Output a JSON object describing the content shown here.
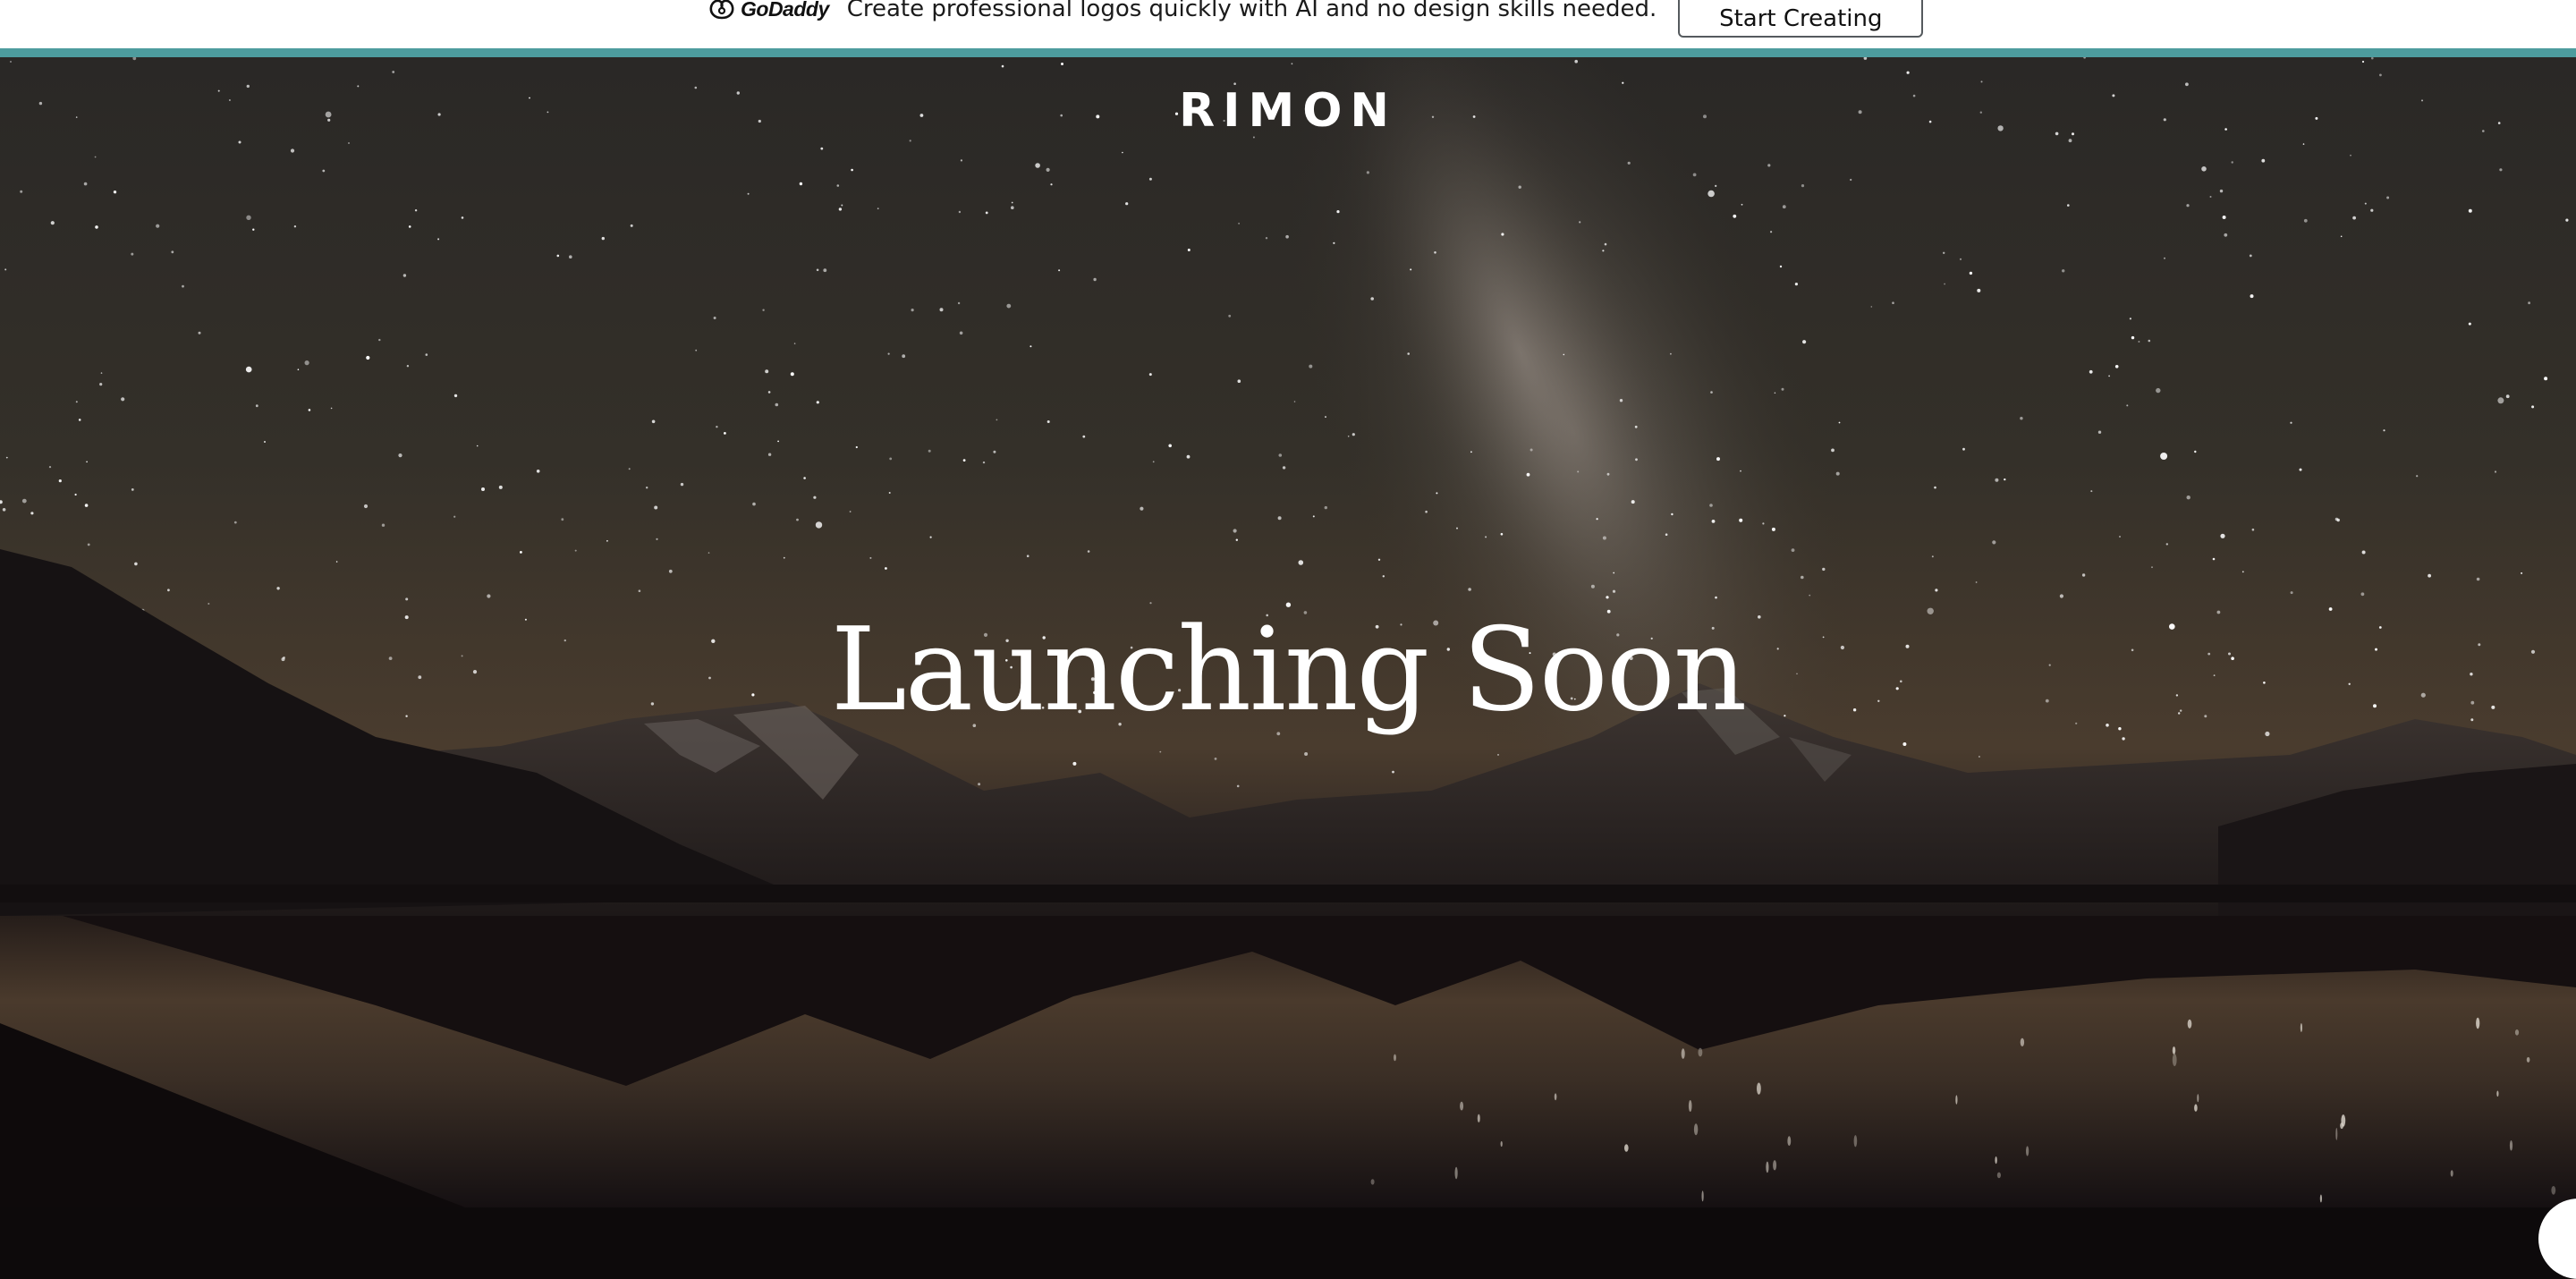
{
  "promo": {
    "brand_name": "GoDaddy",
    "brand_icon": "godaddy-logo-icon",
    "message": "Create professional logos quickly with AI and no design skills needed.",
    "cta_label": "Start Creating",
    "accent_color": "#4d9c9e"
  },
  "site": {
    "logo_text": "RIMON"
  },
  "hero": {
    "headline": "Launching Soon",
    "background": "starry-night-mountain-lake"
  }
}
